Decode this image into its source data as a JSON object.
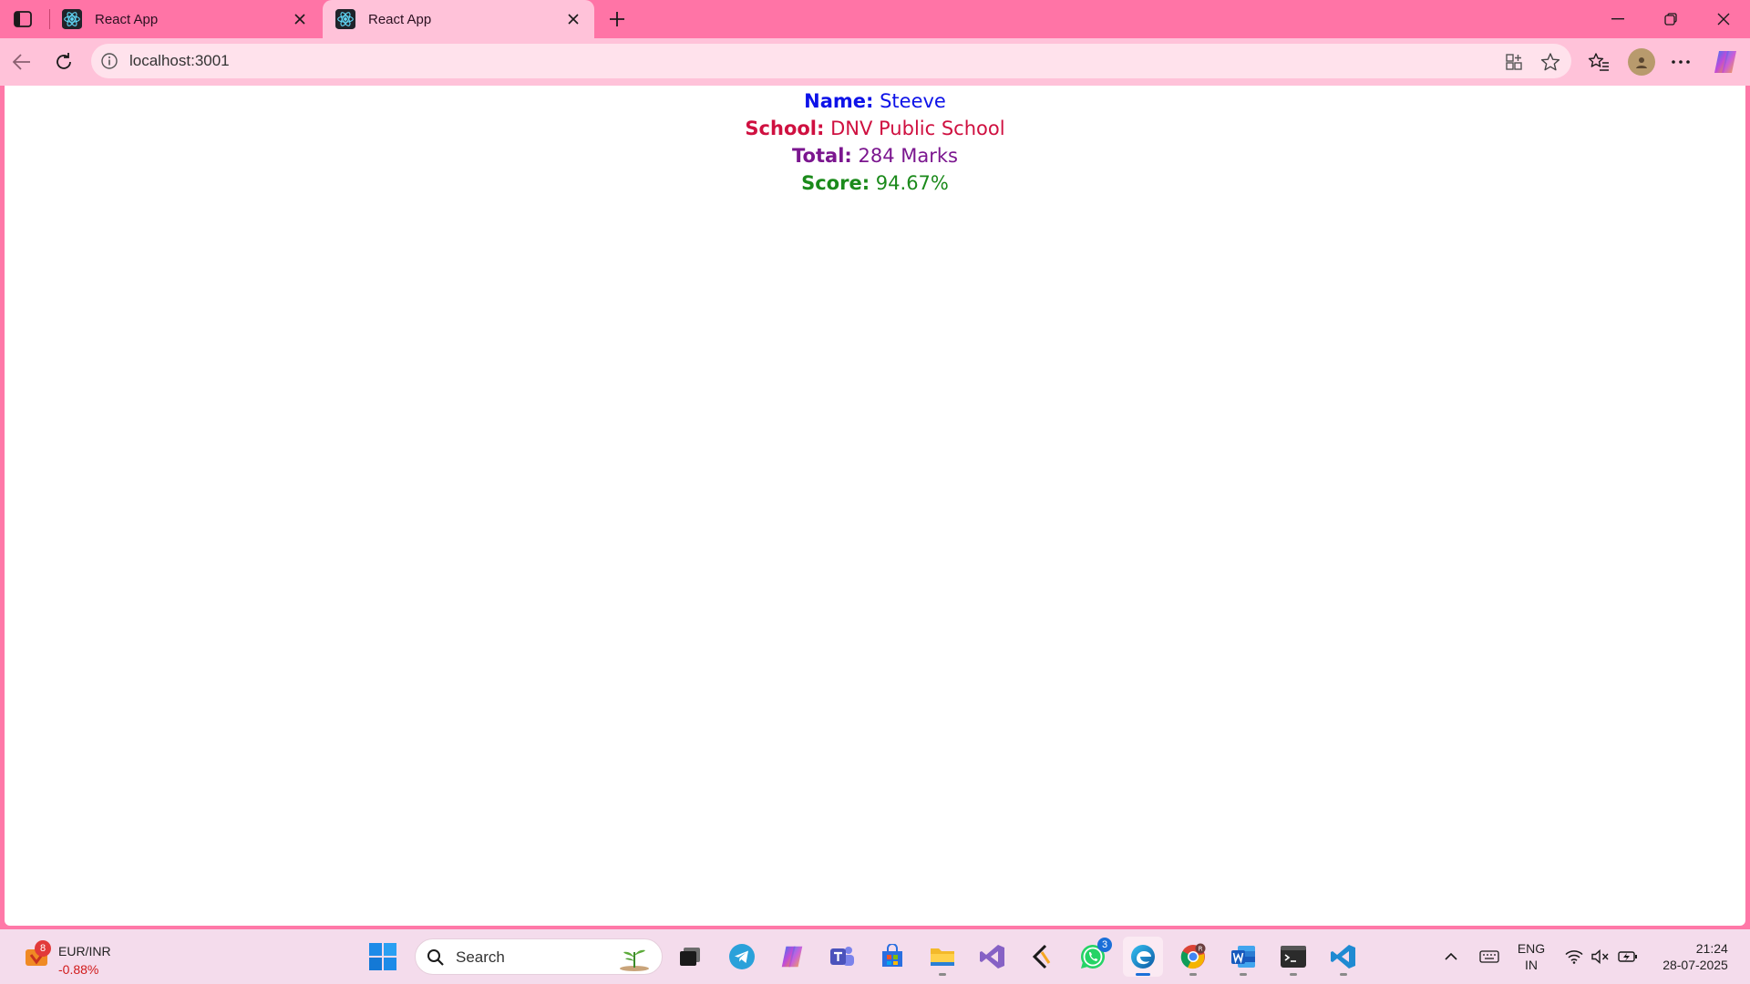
{
  "browser": {
    "tabs": [
      {
        "title": "React App",
        "active": false
      },
      {
        "title": "React App",
        "active": true
      }
    ],
    "address": {
      "url": "localhost:3001"
    }
  },
  "page": {
    "name": {
      "label": "Name:",
      "value": "Steeve",
      "color": "#0d12e8"
    },
    "school": {
      "label": "School:",
      "value": "DNV Public School",
      "color": "#cf1040"
    },
    "total": {
      "label": "Total:",
      "value": "284 Marks",
      "color": "#7b168f"
    },
    "score": {
      "label": "Score:",
      "value": "94.67%",
      "color": "#1b8a1b"
    }
  },
  "taskbar": {
    "widget": {
      "title": "EUR/INR",
      "change": "-0.88%",
      "badge": "8"
    },
    "search": {
      "label": "Search"
    },
    "apps": [
      {
        "name": "task-view",
        "running": false
      },
      {
        "name": "telegram",
        "running": false
      },
      {
        "name": "copilot",
        "running": false
      },
      {
        "name": "teams",
        "running": false
      },
      {
        "name": "store",
        "running": false
      },
      {
        "name": "file-explorer",
        "running": true
      },
      {
        "name": "visual-studio",
        "running": false
      },
      {
        "name": "vs-code-insiders",
        "running": false
      },
      {
        "name": "whatsapp",
        "running": false,
        "badge": "3"
      },
      {
        "name": "edge",
        "running": true
      },
      {
        "name": "chrome",
        "running": true
      },
      {
        "name": "word",
        "running": true
      },
      {
        "name": "terminal",
        "running": true
      },
      {
        "name": "vs-code",
        "running": true
      }
    ],
    "tray": {
      "lang_top": "ENG",
      "lang_bottom": "IN",
      "time": "21:24",
      "date": "28-07-2025"
    }
  },
  "colors": {
    "tabstrip": "#ff74a6",
    "toolbar": "#ffc2d9",
    "taskbar": "#f4dcec"
  }
}
